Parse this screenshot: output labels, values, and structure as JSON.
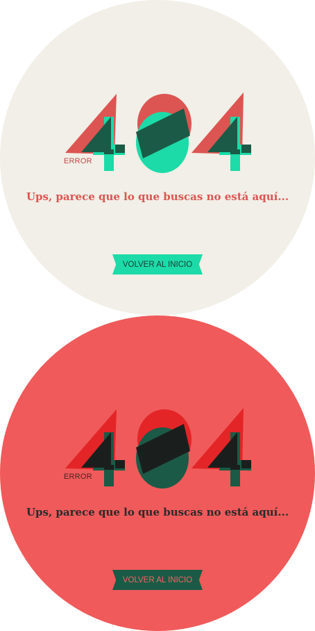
{
  "panels": [
    {
      "theme": "light",
      "code": "404",
      "error_label": "ERROR",
      "message": "Ups, parece que lo que buscas no está aquí...",
      "button_label": "VOLVER AL INICIO",
      "colors": {
        "background": "#f1efe7",
        "primary": "#dc5552",
        "secondary": "#1cdba8",
        "overlap": "#1b5a46"
      }
    },
    {
      "theme": "coral",
      "code": "404",
      "error_label": "ERROR",
      "message": "Ups, parece que lo que buscas no está aquí...",
      "button_label": "VOLVER AL INICIO",
      "colors": {
        "background": "#f05a5a",
        "primary": "#e32527",
        "secondary": "#1b5a46",
        "overlap": "#1a1f1d"
      }
    }
  ]
}
